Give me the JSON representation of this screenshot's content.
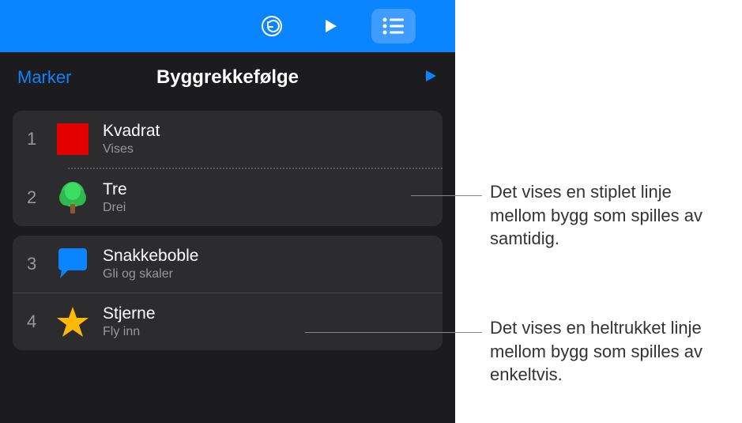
{
  "toolbar": {
    "undo_icon": "undo-icon",
    "play_icon": "play-icon",
    "list_icon": "list-icon"
  },
  "subheader": {
    "marker_label": "Marker",
    "title": "Byggrekkefølge"
  },
  "builds": [
    {
      "num": "1",
      "title": "Kvadrat",
      "subtitle": "Vises",
      "icon": "square"
    },
    {
      "num": "2",
      "title": "Tre",
      "subtitle": "Drei",
      "icon": "tree"
    },
    {
      "num": "3",
      "title": "Snakkeboble",
      "subtitle": "Gli og skaler",
      "icon": "speech"
    },
    {
      "num": "4",
      "title": "Stjerne",
      "subtitle": "Fly inn",
      "icon": "star"
    }
  ],
  "callouts": {
    "dotted": "Det vises en stiplet linje mellom bygg som spilles av samtidig.",
    "solid": "Det vises en heltrukket linje mellom bygg som spilles av enkeltvis."
  }
}
